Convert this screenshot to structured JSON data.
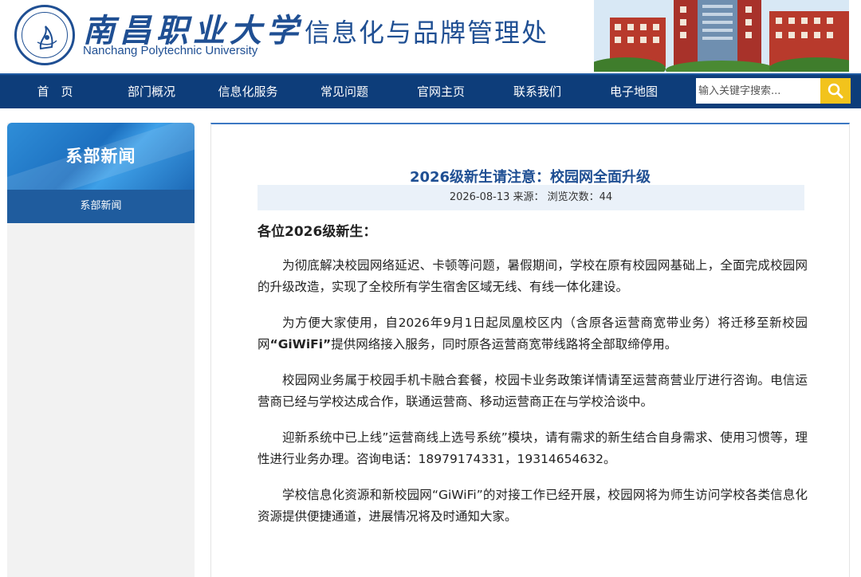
{
  "header": {
    "university_cn": "南昌职业大学",
    "university_en": "Nanchang Polytechnic University",
    "department": "信息化与品牌管理处"
  },
  "nav": {
    "items": [
      "首　页",
      "部门概况",
      "信息化服务",
      "常见问题",
      "官网主页",
      "联系我们",
      "电子地图"
    ],
    "search_placeholder": "输入关键字搜索...",
    "search_icon": "search-icon"
  },
  "sidebar": {
    "title": "系部新闻",
    "items": [
      {
        "label": "系部新闻"
      }
    ]
  },
  "article": {
    "title": "2026级新生请注意：校园网全面升级",
    "meta": "2026-08-13 来源：  浏览次数：44",
    "greeting": "各位2026级新生：",
    "p1": "为彻底解决校园网络延迟、卡顿等问题，暑假期间，学校在原有校园网基础上，全面完成校园网的升级改造，实现了全校所有学生宿舍区域无线、有线一体化建设。",
    "p2_a": "为方便大家使用，自2026年9月1日起凤凰校区内（含原各运营商宽带业务）将迁移至新校园网",
    "p2_b": "“GiWiFi”",
    "p2_c": "提供网络接入服务，同时原各运营商宽带线路将全部取缔停用。",
    "p3": "校园网业务属于校园手机卡融合套餐，校园卡业务政策详情请至运营商营业厅进行咨询。电信运营商已经与学校达成合作，联通运营商、移动运营商正在与学校洽谈中。",
    "p4": "迎新系统中已上线”运营商线上选号系统”模块，请有需求的新生结合自身需求、使用习惯等，理性进行业务办理。咨询电话：18979174331，19314654632。",
    "p5": "学校信息化资源和新校园网“GiWiFi”的对接工作已经开展，校园网将为师生访问学校各类信息化资源提供便捷通道，进展情况将及时通知大家。"
  },
  "colors": {
    "brand_blue": "#1f4f93",
    "nav_bg": "#0d3d7a",
    "search_button": "#f2c31c",
    "sidebar_active": "#1f5c9e"
  }
}
